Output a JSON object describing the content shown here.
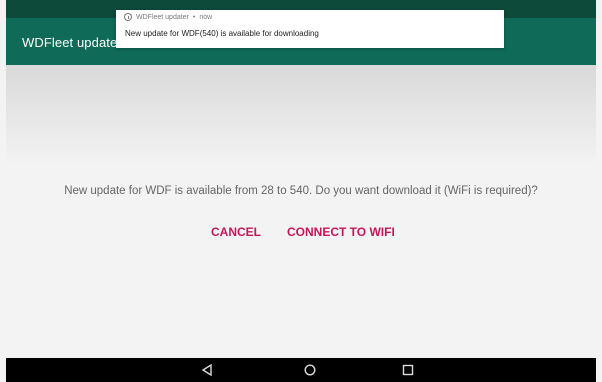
{
  "app": {
    "title": "WDFleet updater"
  },
  "notification": {
    "app_name": "WDFleet updater",
    "time": "now",
    "message": "New update for WDF(540) is available for downloading"
  },
  "dialog": {
    "message": "New update for WDF is available from 28 to 540. Do you want download it (WiFi is required)?",
    "cancel_label": "CANCEL",
    "connect_label": "CONNECT TO WIFI"
  },
  "navigation": {
    "icons": [
      "back-icon",
      "home-icon",
      "recents-icon"
    ]
  },
  "colors": {
    "app_bar": "#0f6a57",
    "status_bar": "#0d4a3a",
    "accent": "#c2185b"
  }
}
